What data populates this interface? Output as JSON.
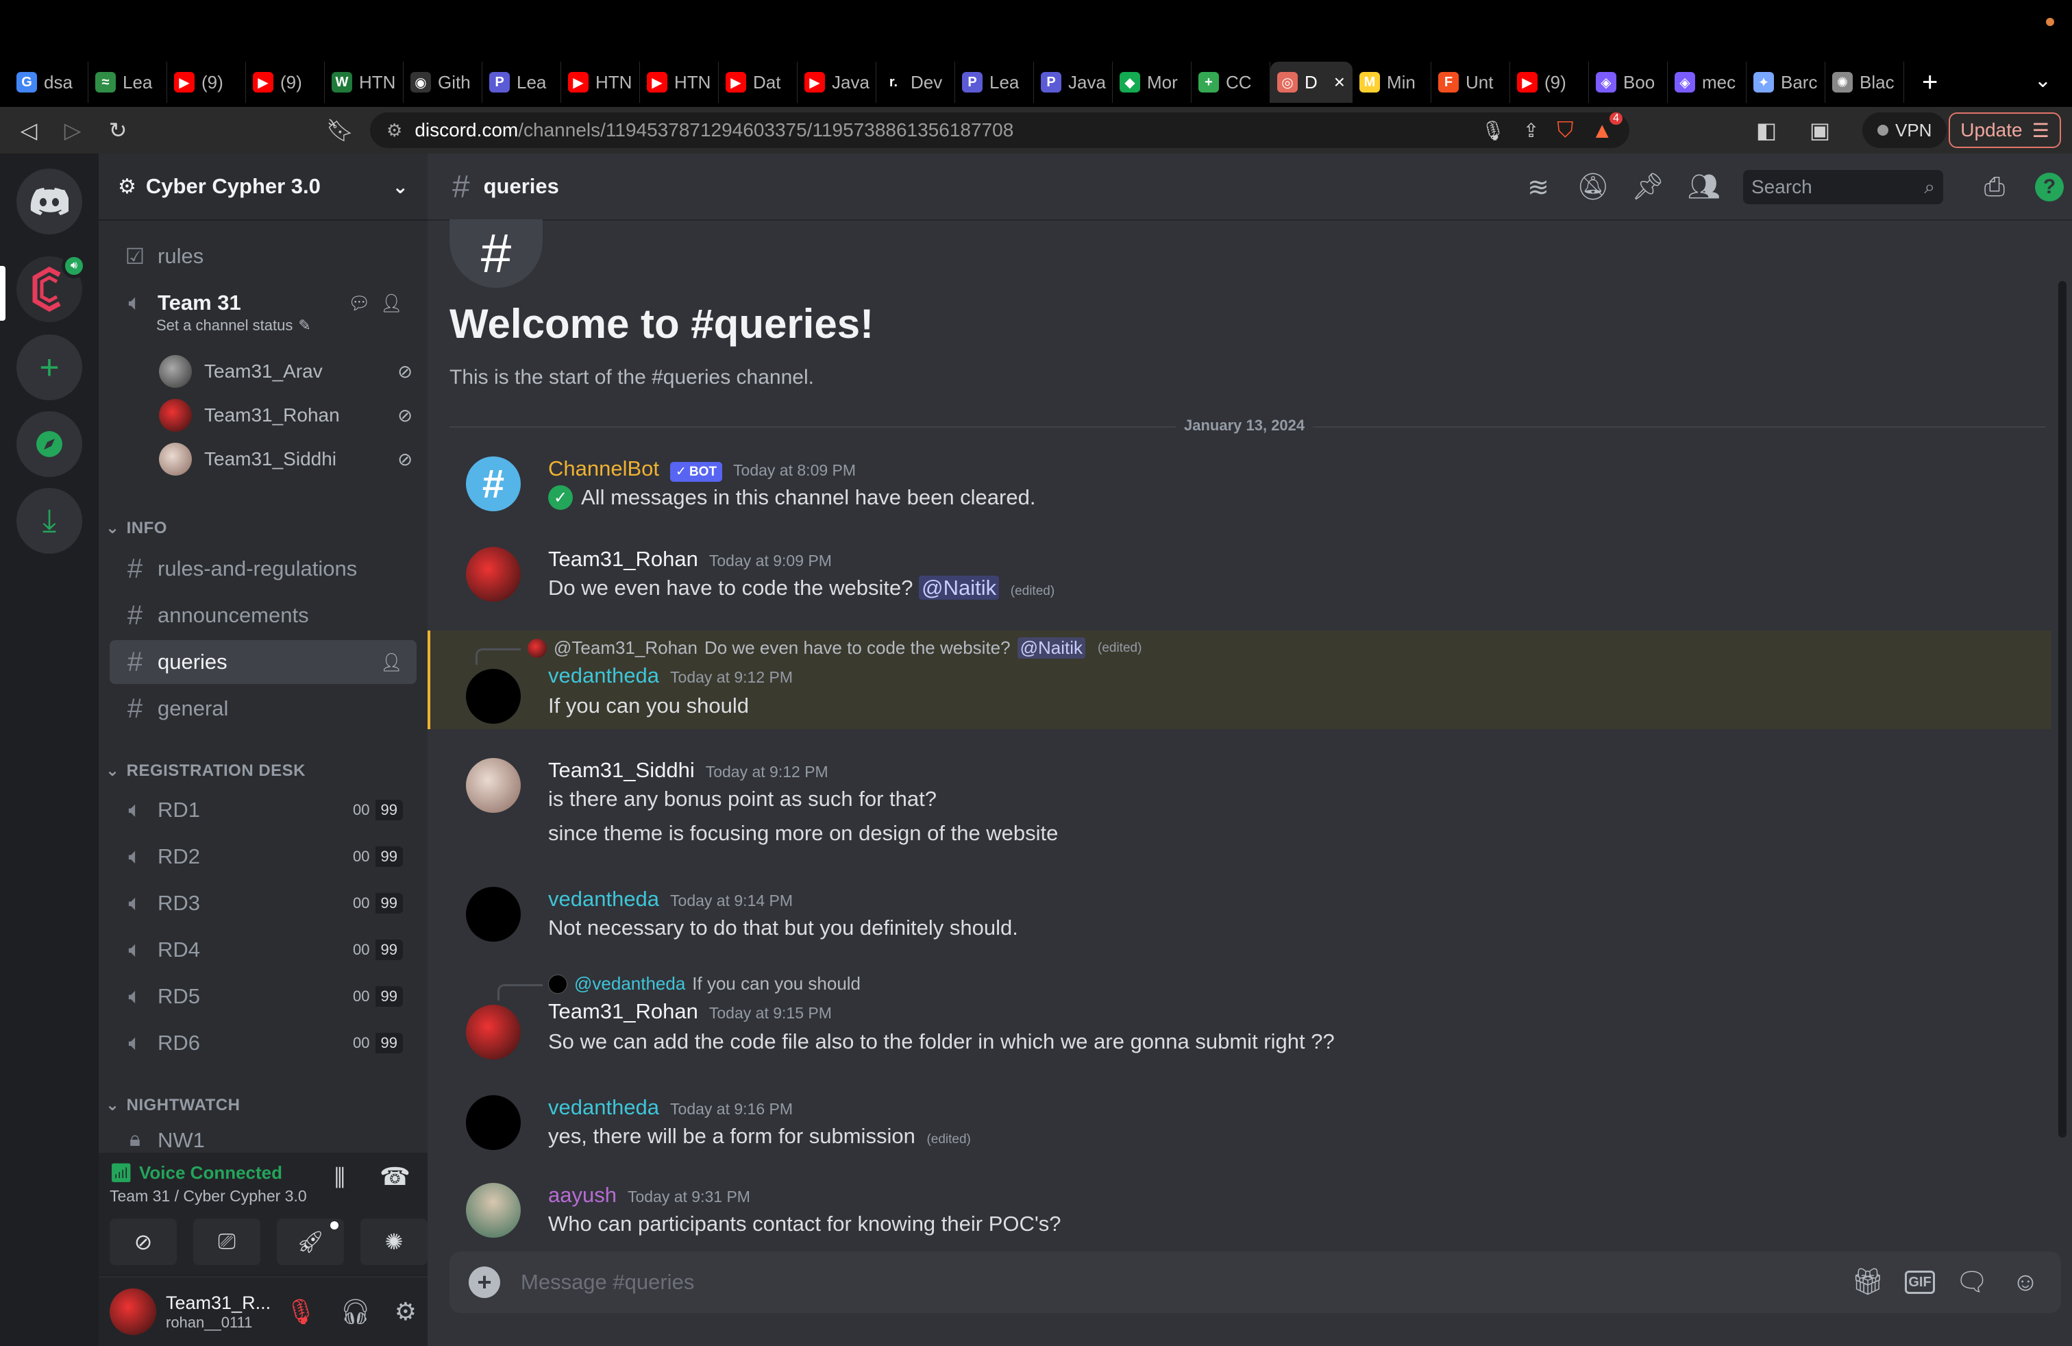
{
  "browser": {
    "tabs": [
      {
        "label": "dsa",
        "icon": "google-icon",
        "color": "#4285f4",
        "glyph": "G"
      },
      {
        "label": "Lea",
        "icon": "leetcode-icon",
        "color": "#2f8d46",
        "glyph": "≈"
      },
      {
        "label": "(9)",
        "icon": "youtube-icon",
        "color": "#ff0000",
        "glyph": "▶"
      },
      {
        "label": "(9)",
        "icon": "youtube-icon",
        "color": "#ff0000",
        "glyph": "▶"
      },
      {
        "label": "HTN",
        "icon": "w-icon",
        "color": "#1f7a3a",
        "glyph": "W"
      },
      {
        "label": "Gith",
        "icon": "github-icon",
        "color": "#333333",
        "glyph": "◉"
      },
      {
        "label": "Lea",
        "icon": "p-icon",
        "color": "#5b5bd6",
        "glyph": "P"
      },
      {
        "label": "HTN",
        "icon": "youtube-icon",
        "color": "#ff0000",
        "glyph": "▶"
      },
      {
        "label": "HTN",
        "icon": "youtube-icon",
        "color": "#ff0000",
        "glyph": "▶"
      },
      {
        "label": "Dat",
        "icon": "youtube-icon",
        "color": "#ff0000",
        "glyph": "▶"
      },
      {
        "label": "Java",
        "icon": "youtube-icon",
        "color": "#ff0000",
        "glyph": "▶"
      },
      {
        "label": "Dev",
        "icon": "r-icon",
        "color": "#000000",
        "glyph": "r."
      },
      {
        "label": "Lea",
        "icon": "p-icon",
        "color": "#5b5bd6",
        "glyph": "P"
      },
      {
        "label": "Java",
        "icon": "p-icon",
        "color": "#5b5bd6",
        "glyph": "P"
      },
      {
        "label": "Mor",
        "icon": "mongodb-icon",
        "color": "#13aa52",
        "glyph": "◆"
      },
      {
        "label": "CC",
        "icon": "sheets-icon",
        "color": "#34a853",
        "glyph": "+"
      },
      {
        "label": "D",
        "icon": "discord-tab-icon",
        "color": "#e36b5d",
        "glyph": "◎",
        "active": true
      },
      {
        "label": "Min",
        "icon": "miro-icon",
        "color": "#ffd02f",
        "glyph": "M"
      },
      {
        "label": "Unt",
        "icon": "figma-icon",
        "color": "#f24e1e",
        "glyph": "F"
      },
      {
        "label": "(9)",
        "icon": "youtube-icon",
        "color": "#ff0000",
        "glyph": "▶"
      },
      {
        "label": "Boo",
        "icon": "diamond-icon",
        "color": "#7b5cff",
        "glyph": "◈"
      },
      {
        "label": "mec",
        "icon": "diamond-icon",
        "color": "#7b5cff",
        "glyph": "◈"
      },
      {
        "label": "Barc",
        "icon": "bard-icon",
        "color": "#7aa7ff",
        "glyph": "✦"
      },
      {
        "label": "Blac",
        "icon": "blackbox-icon",
        "color": "#888888",
        "glyph": "✺"
      }
    ],
    "url_host": "discord.com",
    "url_path": "/channels/1194537871294603375/1195738861356187708",
    "vpn_label": "VPN",
    "update_label": "Update",
    "brave_badge": "4"
  },
  "server": {
    "name": "Cyber Cypher 3.0"
  },
  "sidebar": {
    "rules": "rules",
    "team_channel": "Team 31",
    "team_status": "Set a channel status",
    "members": [
      "Team31_Arav",
      "Team31_Rohan",
      "Team31_Siddhi"
    ],
    "cat_info": "INFO",
    "info_channels": [
      "rules-and-regulations",
      "announcements",
      "queries",
      "general"
    ],
    "cat_reg": "REGISTRATION DESK",
    "rd_channels": [
      "RD1",
      "RD2",
      "RD3",
      "RD4",
      "RD5",
      "RD6"
    ],
    "rd_count_a": "00",
    "rd_count_b": "99",
    "cat_night": "NIGHTWATCH",
    "nw_channel": "NW1"
  },
  "voice": {
    "status": "Voice Connected",
    "location": "Team 31 / Cyber Cypher 3.0"
  },
  "user": {
    "display": "Team31_R...",
    "handle": "rohan__0111"
  },
  "channel": {
    "name": "queries",
    "search_placeholder": "Search",
    "welcome_title": "Welcome to #queries!",
    "welcome_sub": "This is the start of the #queries channel.",
    "date_divider": "January 13, 2024",
    "composer_placeholder": "Message #queries"
  },
  "messages": [
    {
      "user": "ChannelBot",
      "bot": "BOT",
      "time": "Today at 8:09 PM",
      "text": "All messages in this channel have been cleared."
    },
    {
      "user": "Team31_Rohan",
      "time": "Today at 9:09 PM",
      "text": "Do we even have to code the website?",
      "mention": "@Naitik",
      "edited": "(edited)"
    },
    {
      "reply_user": "@Team31_Rohan",
      "reply_text": "Do we even have to code the website?",
      "reply_mention": "@Naitik",
      "reply_edited": "(edited)",
      "user": "vedantheda",
      "time": "Today at 9:12 PM",
      "text": "If you can you should"
    },
    {
      "user": "Team31_Siddhi",
      "time": "Today at 9:12 PM",
      "text": "is there any bonus point as such for that?",
      "text2": "since theme is focusing more on design of the website"
    },
    {
      "user": "vedantheda",
      "time": "Today at 9:14 PM",
      "text": "Not necessary to do that but you definitely should."
    },
    {
      "reply_user": "@vedantheda",
      "reply_text": "If you can you should",
      "user": "Team31_Rohan",
      "time": "Today at 9:15 PM",
      "text": "So we can add the code file also to the folder in which we are gonna submit right ??"
    },
    {
      "user": "vedantheda",
      "time": "Today at 9:16 PM",
      "text": "yes, there will be a form for submission",
      "edited": "(edited)"
    },
    {
      "user": "aayush",
      "time": "Today at 9:31 PM",
      "text": "Who can participants contact for knowing their POC's?"
    }
  ],
  "colors": {
    "bot_name": "#f0b232",
    "vedantheda": "#3ec6d9",
    "aayush": "#b76cd4",
    "voice_green": "#23a55a",
    "highlight_bg": "#3b3a2f",
    "highlight_bar": "#f0b232",
    "blurple": "#5865f2"
  }
}
